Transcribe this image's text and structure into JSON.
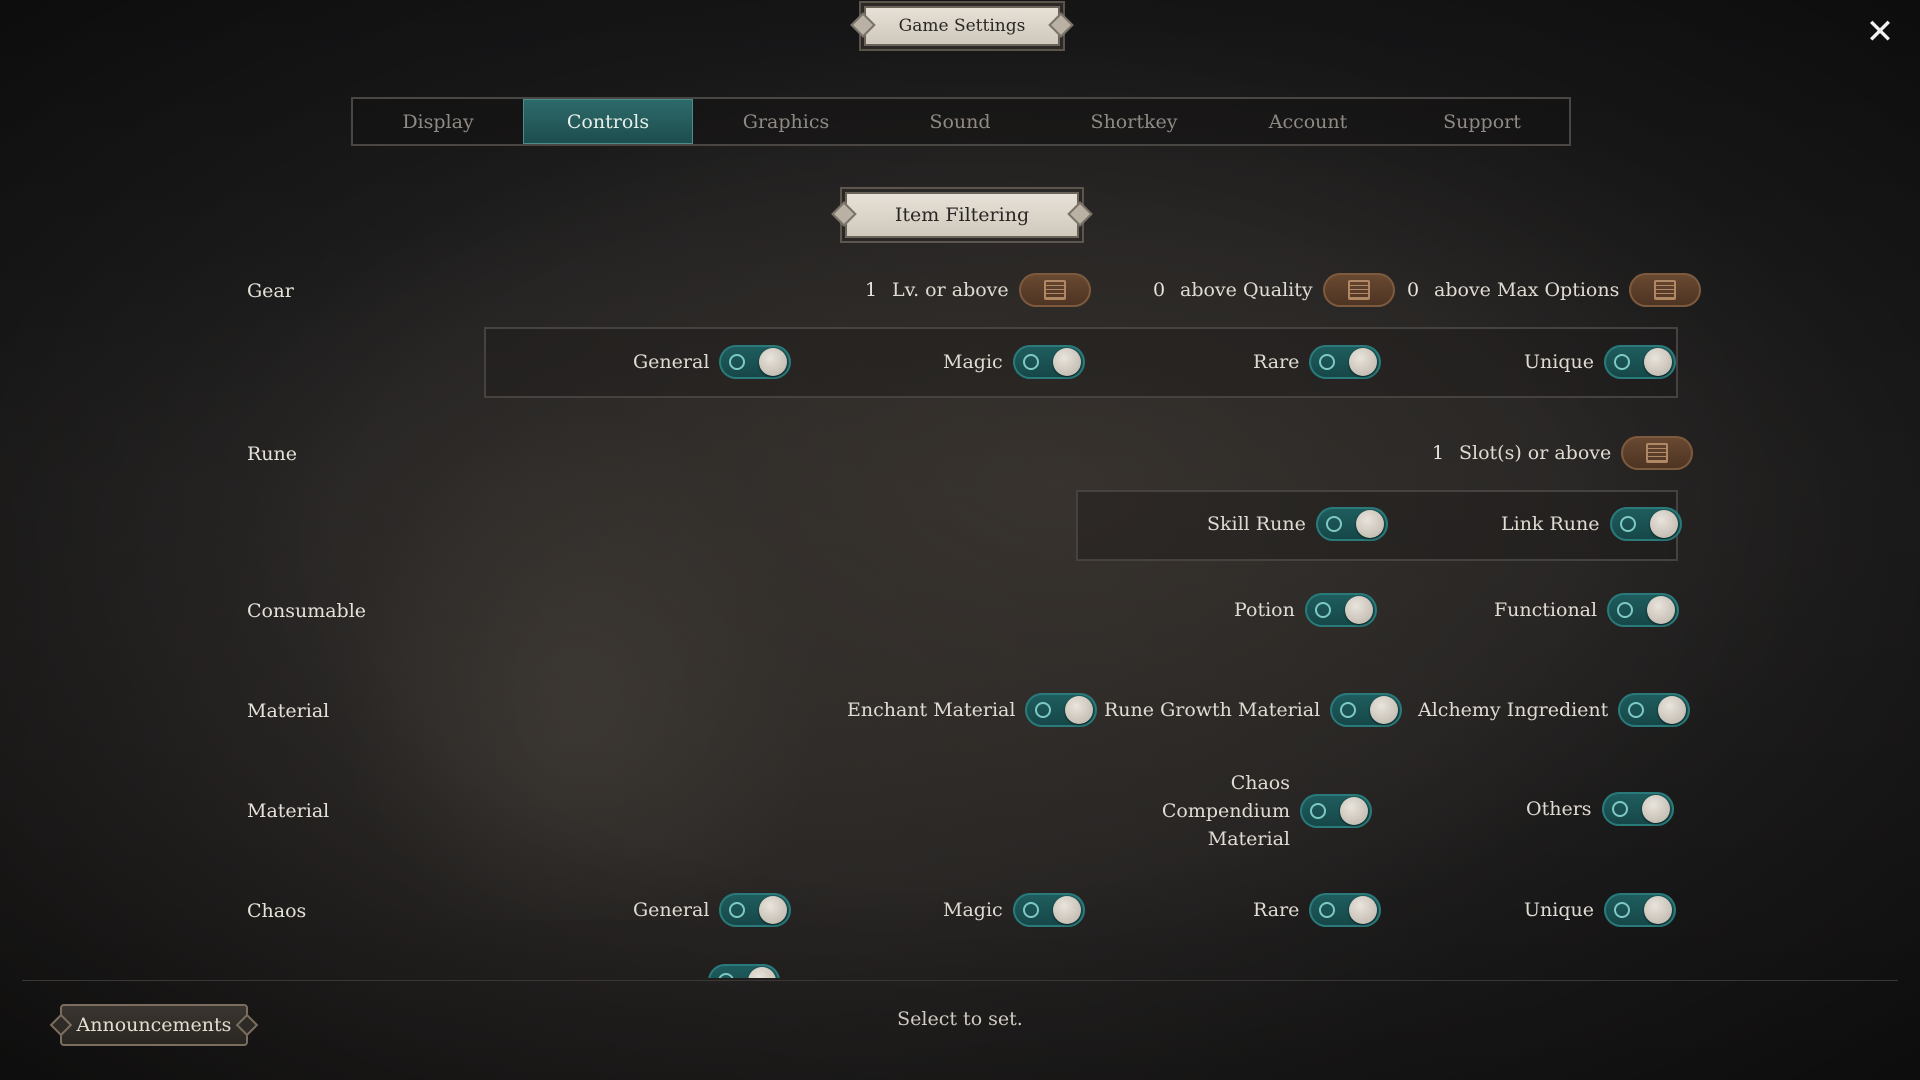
{
  "window": {
    "title": "Game Settings",
    "close_icon": "close-icon"
  },
  "tabs": [
    {
      "label": "Display",
      "active": false
    },
    {
      "label": "Controls",
      "active": true
    },
    {
      "label": "Graphics",
      "active": false
    },
    {
      "label": "Sound",
      "active": false
    },
    {
      "label": "Shortkey",
      "active": false
    },
    {
      "label": "Account",
      "active": false
    },
    {
      "label": "Support",
      "active": false
    }
  ],
  "section": {
    "title": "Item Filtering"
  },
  "gear": {
    "label": "Gear",
    "level": {
      "value": "1",
      "label": "Lv. or above"
    },
    "quality": {
      "value": "0",
      "label": "above Quality"
    },
    "max_options": {
      "value": "0",
      "label": "above Max Options"
    },
    "general": "General",
    "magic": "Magic",
    "rare": "Rare",
    "unique": "Unique"
  },
  "rune": {
    "label": "Rune",
    "slots": {
      "value": "1",
      "label": "Slot(s) or above"
    },
    "skill_rune": "Skill Rune",
    "link_rune": "Link Rune"
  },
  "consumable": {
    "label": "Consumable",
    "potion": "Potion",
    "functional": "Functional"
  },
  "material1": {
    "label": "Material",
    "enchant": "Enchant Material",
    "rune_growth": "Rune Growth Material",
    "alchemy": "Alchemy Ingredient"
  },
  "material2": {
    "label": "Material",
    "chaos_compendium": "Chaos Compendium Material",
    "others": "Others"
  },
  "chaos": {
    "label": "Chaos",
    "general": "General",
    "magic": "Magic",
    "rare": "Rare",
    "unique": "Unique"
  },
  "footer": {
    "announcements": "Announcements",
    "hint": "Select to set."
  },
  "colors": {
    "toggle_on": "#1f5e5f",
    "edit_button": "#6a4a32",
    "active_tab": "#2e6a6b"
  }
}
